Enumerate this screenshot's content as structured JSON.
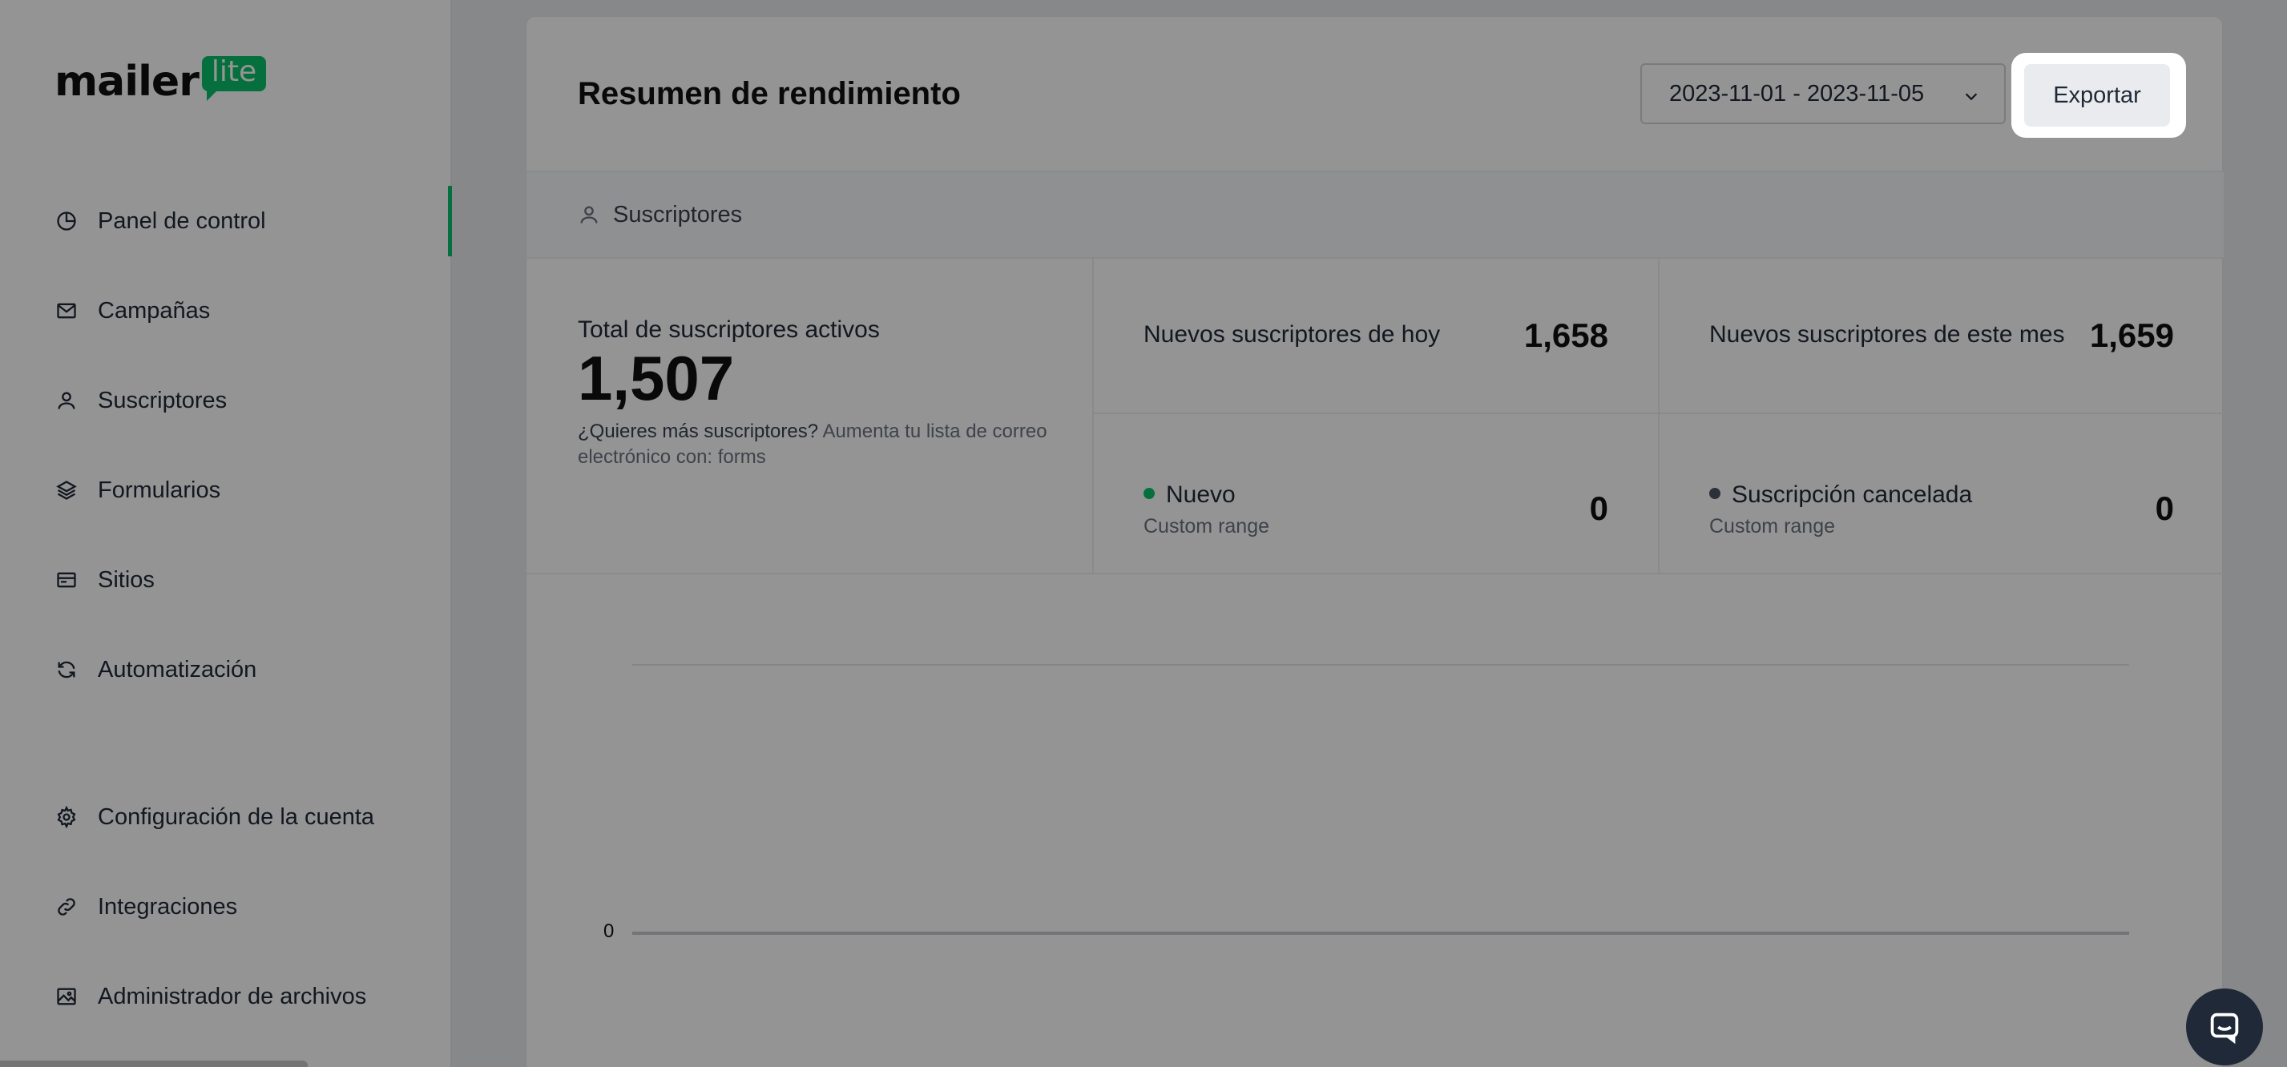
{
  "app": {
    "logo_text": "mailer",
    "logo_badge": "lite"
  },
  "sidebar": {
    "items": [
      {
        "label": "Panel de control",
        "icon": "chart-pie-icon",
        "active": true
      },
      {
        "label": "Campañas",
        "icon": "mail-icon"
      },
      {
        "label": "Suscriptores",
        "icon": "user-icon"
      },
      {
        "label": "Formularios",
        "icon": "layers-icon"
      },
      {
        "label": "Sitios",
        "icon": "browser-window-icon"
      },
      {
        "label": "Automatización",
        "icon": "refresh-icon"
      },
      {
        "label": "Configuración de la cuenta",
        "icon": "gear-icon"
      },
      {
        "label": "Integraciones",
        "icon": "link-icon"
      },
      {
        "label": "Administrador de archivos",
        "icon": "image-icon"
      }
    ]
  },
  "header": {
    "title": "Resumen de rendimiento",
    "date_range": "2023-11-01 - 2023-11-05",
    "export_label": "Exportar"
  },
  "subheader": {
    "label": "Suscriptores"
  },
  "stats": {
    "total_label": "Total de suscriptores activos",
    "total_value": "1,507",
    "hint_bold": "¿Quieres más suscriptores?",
    "hint_rest": " Aumenta tu lista de correo electrónico con: forms",
    "today_label": "Nuevos suscriptores de hoy",
    "today_value": "1,658",
    "month_label": "Nuevos suscriptores de este mes",
    "month_value": "1,659",
    "new_label": "Nuevo",
    "new_sub": "Custom range",
    "new_value": "0",
    "new_color": "#09c269",
    "unsub_label": "Suscripción cancelada",
    "unsub_sub": "Custom range",
    "unsub_value": "0",
    "unsub_color": "#4b5563"
  },
  "chart": {
    "zero_tick": "0"
  },
  "colors": {
    "accent": "#09c269",
    "overlay": "rgba(0,0,0,0.42)"
  }
}
